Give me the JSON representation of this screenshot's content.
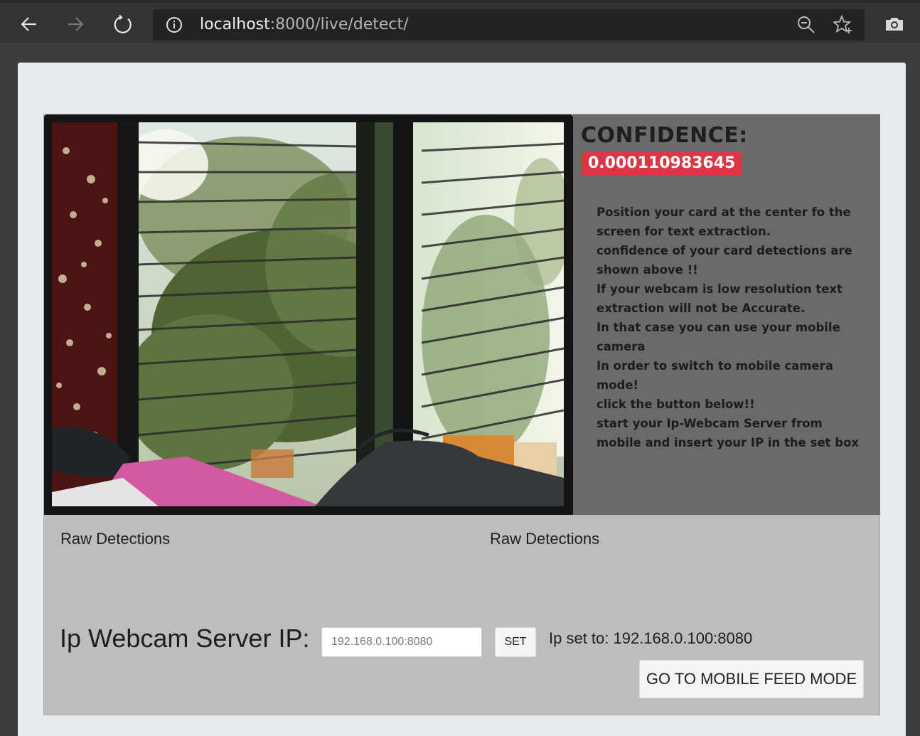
{
  "browser": {
    "url_host": "localhost",
    "url_path": ":8000/live/detect/",
    "icons": [
      "back-arrow-icon",
      "forward-arrow-icon",
      "reload-icon",
      "info-icon",
      "zoom-icon",
      "star-icon",
      "camera-icon"
    ]
  },
  "confidence": {
    "title": "CONFIDENCE:",
    "value": "0.000110983645",
    "badge_color": "#dc3545"
  },
  "instructions": [
    "Position your card at the center fo the screen for text extraction.",
    "confidence of your card detections are shown above !!",
    "If your webcam is low resolution text extraction will not be Accurate.",
    "In that case you can use your mobile camera",
    "In order to switch to mobile camera mode!",
    "click the button below!!",
    "start your Ip-Webcam Server from mobile and insert your IP in the set box"
  ],
  "raw_detections": {
    "left_label": "Raw Detections",
    "right_label": "Raw Detections"
  },
  "ip_form": {
    "label": "Ip Webcam Server IP:",
    "placeholder": "192.168.0.100:8080",
    "set_label": "SET",
    "status": "Ip set to: 192.168.0.100:8080"
  },
  "mobile_button": {
    "label": "GO TO MOBILE FEED MODE"
  }
}
